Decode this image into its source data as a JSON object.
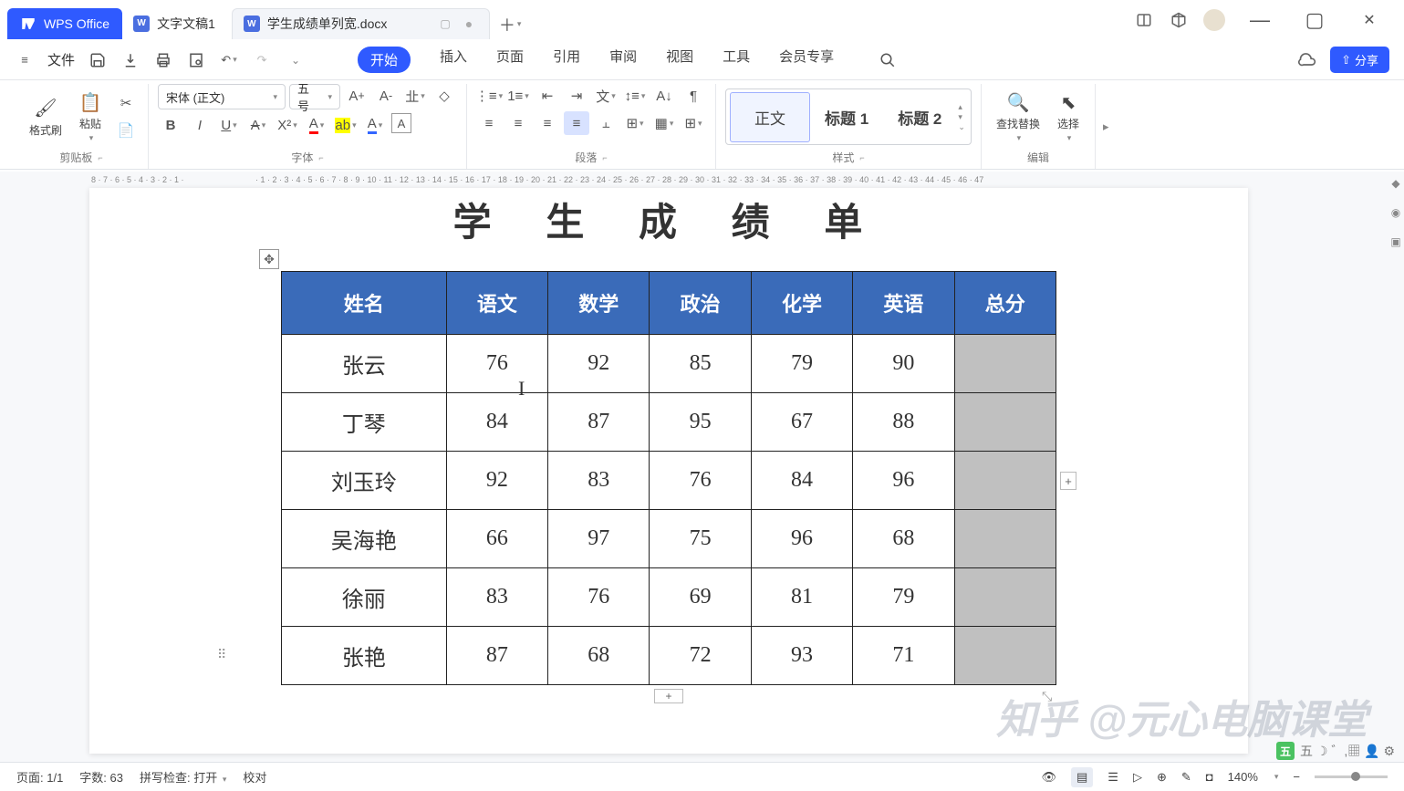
{
  "app": {
    "name": "WPS Office"
  },
  "tabs": [
    {
      "label": "文字文稿1",
      "active": false
    },
    {
      "label": "学生成绩单列宽.docx",
      "active": true
    }
  ],
  "menu": {
    "file": "文件",
    "items": [
      "开始",
      "插入",
      "页面",
      "引用",
      "审阅",
      "视图",
      "工具",
      "会员专享"
    ],
    "active": "开始"
  },
  "share": "分享",
  "ribbon": {
    "clipboard": {
      "label": "剪贴板",
      "format": "格式刷",
      "paste": "粘贴"
    },
    "font": {
      "label": "字体",
      "name": "宋体 (正文)",
      "size": "五号"
    },
    "paragraph": {
      "label": "段落"
    },
    "styles": {
      "label": "样式",
      "items": [
        "正文",
        "标题 1",
        "标题 2"
      ]
    },
    "edit": {
      "label": "编辑",
      "find": "查找替换",
      "select": "选择"
    }
  },
  "document": {
    "title": "学 生 成 绩 单",
    "headers": [
      "姓名",
      "语文",
      "数学",
      "政治",
      "化学",
      "英语",
      "总分"
    ],
    "rows": [
      [
        "张云",
        "76",
        "92",
        "85",
        "79",
        "90",
        ""
      ],
      [
        "丁琴",
        "84",
        "87",
        "95",
        "67",
        "88",
        ""
      ],
      [
        "刘玉玲",
        "92",
        "83",
        "76",
        "84",
        "96",
        ""
      ],
      [
        "吴海艳",
        "66",
        "97",
        "75",
        "96",
        "68",
        ""
      ],
      [
        "徐丽",
        "83",
        "76",
        "69",
        "81",
        "79",
        ""
      ],
      [
        "张艳",
        "87",
        "68",
        "72",
        "93",
        "71",
        ""
      ]
    ]
  },
  "status": {
    "page": "页面: 1/1",
    "words": "字数: 63",
    "spell": "拼写检查: 打开",
    "proof": "校对",
    "zoom": "140%"
  },
  "watermark": "知乎 @元心电脑课堂",
  "ime": "五"
}
